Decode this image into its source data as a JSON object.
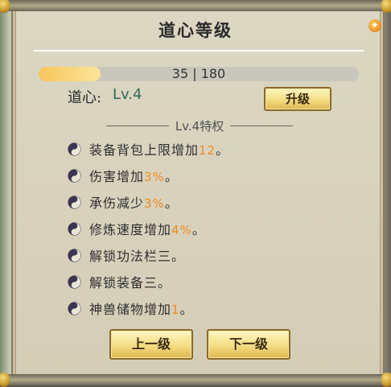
{
  "panel": {
    "title": "道心等级",
    "help_icon": "fire-icon"
  },
  "progress": {
    "current": 35,
    "max": 180,
    "text": "35 | 180",
    "fill_fraction": 0.194
  },
  "level": {
    "label": "道心:",
    "value": "Lv.4",
    "upgrade_button": "升级"
  },
  "privileges_header": "Lv.4特权",
  "privileges": [
    {
      "prefix": "装备背包上限增加",
      "highlight": "12",
      "suffix": "。"
    },
    {
      "prefix": "伤害增加",
      "highlight": "3%",
      "suffix": "。"
    },
    {
      "prefix": "承伤减少",
      "highlight": "3%",
      "suffix": "。"
    },
    {
      "prefix": "修炼速度增加",
      "highlight": "4%",
      "suffix": "。"
    },
    {
      "prefix": "解锁功法栏三。",
      "highlight": "",
      "suffix": ""
    },
    {
      "prefix": "解锁装备三。",
      "highlight": "",
      "suffix": ""
    },
    {
      "prefix": "神兽储物增加",
      "highlight": "1",
      "suffix": "。"
    }
  ],
  "nav": {
    "prev": "上一级",
    "next": "下一级"
  },
  "colors": {
    "highlight": "#f08a1e",
    "level_value": "#2f6a5b",
    "progress_fill": "#f6c55a"
  }
}
